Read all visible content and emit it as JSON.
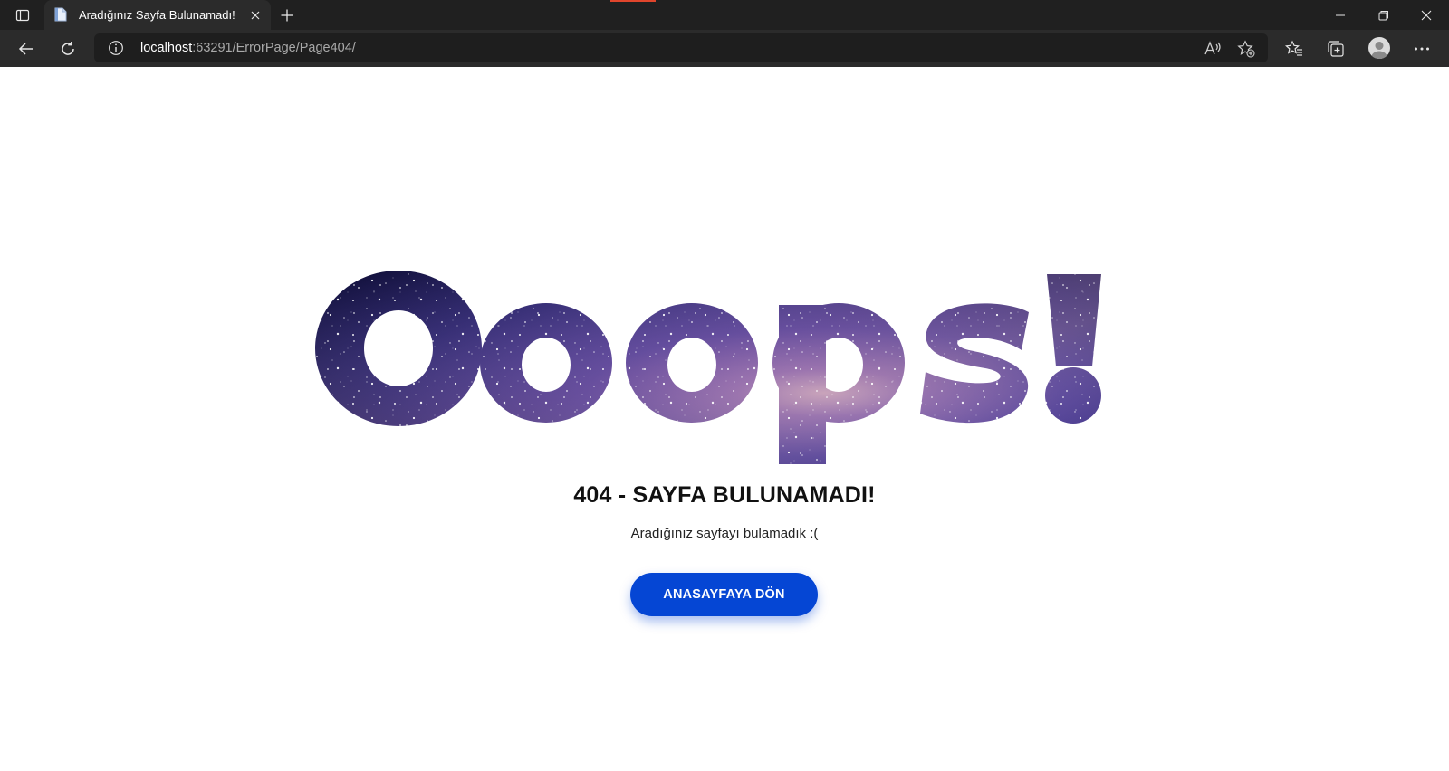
{
  "browser": {
    "tab": {
      "title": "Aradığınız Sayfa Bulunamadı!"
    },
    "address": {
      "host": "localhost",
      "rest": ":63291/ErrorPage/Page404/"
    }
  },
  "page": {
    "headline": "Ooops!",
    "error_title": "404 - SAYFA BULUNAMADI!",
    "error_subtitle": "Aradığınız sayfayı bulamadık :(",
    "home_button_label": "ANASAYFAYA DÖN"
  },
  "colors": {
    "button": "#0546d4",
    "galaxy_dark": "#0e0a3a",
    "galaxy_mid": "#3b2a8c",
    "galaxy_glow": "#a88ab8"
  },
  "icons": {
    "tab_actions": "tab-actions-icon",
    "favicon": "page-document-icon",
    "close": "close-icon",
    "new_tab": "plus-icon",
    "minimize": "minimize-icon",
    "restore": "restore-icon",
    "window_close": "window-close-icon",
    "back": "back-arrow-icon",
    "refresh": "refresh-icon",
    "site_info": "info-icon",
    "read_aloud": "read-aloud-icon",
    "add_favorite": "star-plus-icon",
    "favorites": "favorites-list-icon",
    "collections": "collections-icon",
    "profile": "profile-avatar-icon",
    "more": "more-dots-icon"
  }
}
